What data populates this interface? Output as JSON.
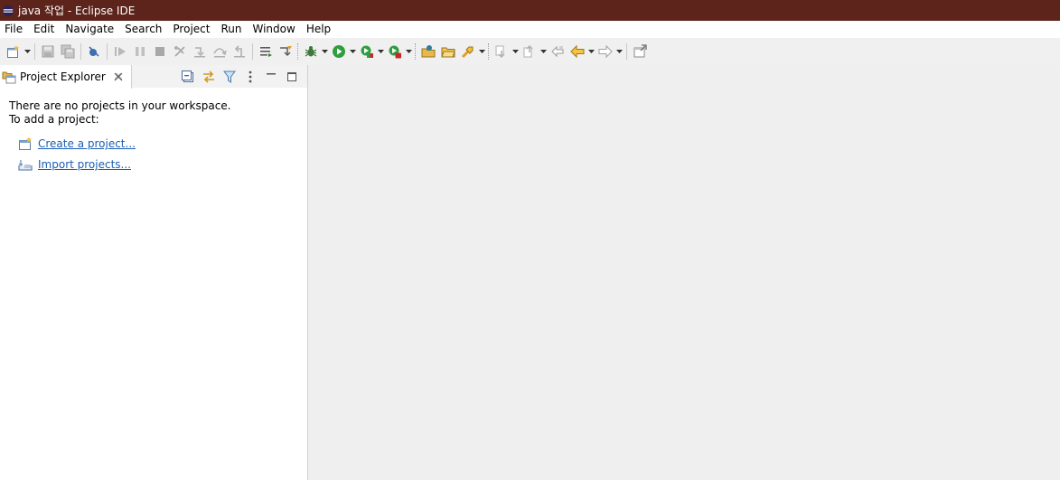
{
  "window": {
    "title": "java 작업 - Eclipse IDE",
    "titlebar_color": "#5c241b"
  },
  "menu": [
    "File",
    "Edit",
    "Navigate",
    "Search",
    "Project",
    "Run",
    "Window",
    "Help"
  ],
  "toolbar_icons": [
    "new-icon",
    "save-icon",
    "save-all-icon",
    "skip-breakpoints-icon",
    "resume-icon",
    "suspend-icon",
    "terminate-icon",
    "disconnect-icon",
    "step-into-icon",
    "step-over-icon",
    "step-return-icon",
    "drop-to-frame-icon",
    "use-step-filters-icon",
    "debug-icon",
    "run-icon",
    "coverage-icon",
    "external-tools-icon",
    "open-type-icon",
    "open-task-icon",
    "search-icon",
    "next-annotation-icon",
    "previous-annotation-icon",
    "last-edit-location-icon",
    "back-icon",
    "forward-icon",
    "pin-editor-icon"
  ],
  "project_explorer": {
    "tab_label": "Project Explorer",
    "empty_message_line1": "There are no projects in your workspace.",
    "empty_message_line2": "To add a project:",
    "create_link": "Create a project...",
    "import_link": "Import projects..."
  },
  "colors": {
    "link": "#1a5fb4",
    "editor_bg": "#efefef"
  }
}
